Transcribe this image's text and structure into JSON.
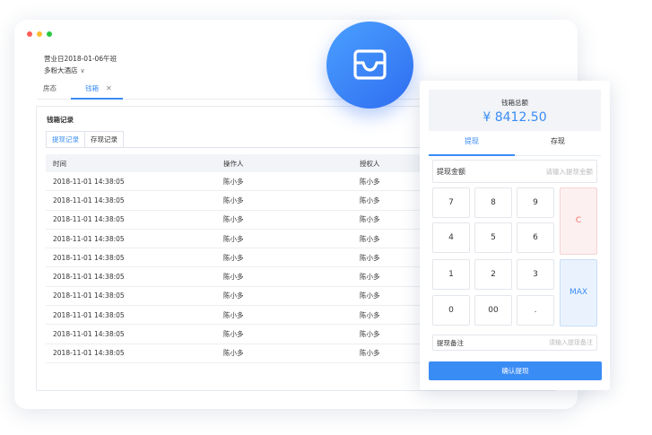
{
  "window_controls": {
    "colors": [
      "#ff5f57",
      "#ffbd2e",
      "#28c940"
    ]
  },
  "business_info": {
    "business_day": "营业日2018-01-06午班",
    "store": "多粉大酒店",
    "store_dropdown_icon": "chevron-down-icon"
  },
  "tabs": [
    {
      "label": "房态",
      "active": false
    },
    {
      "label": "钱箱",
      "active": true,
      "close_icon": "close-icon"
    }
  ],
  "panel": {
    "title": "钱箱记录",
    "subtabs": [
      {
        "label": "提现记录",
        "active": true
      },
      {
        "label": "存现记录",
        "active": false
      }
    ],
    "table": {
      "headers": [
        "时间",
        "操作人",
        "授权人"
      ],
      "rows": [
        [
          "2018-11-01 14:38:05",
          "陈小多",
          "陈小多"
        ],
        [
          "2018-11-01 14:38:05",
          "陈小多",
          "陈小多"
        ],
        [
          "2018-11-01 14:38:05",
          "陈小多",
          "陈小多"
        ],
        [
          "2018-11-01 14:38:05",
          "陈小多",
          "陈小多"
        ],
        [
          "2018-11-01 14:38:05",
          "陈小多",
          "陈小多"
        ],
        [
          "2018-11-01 14:38:05",
          "陈小多",
          "陈小多"
        ],
        [
          "2018-11-01 14:38:05",
          "陈小多",
          "陈小多"
        ],
        [
          "2018-11-01 14:38:05",
          "陈小多",
          "陈小多"
        ],
        [
          "2018-11-01 14:38:05",
          "陈小多",
          "陈小多"
        ],
        [
          "2018-11-01 14:38:05",
          "陈小多",
          "陈小多"
        ]
      ]
    }
  },
  "logo": {
    "icon": "cash-drawer-icon"
  },
  "cashier": {
    "label": "钱箱总额",
    "amount": "¥ 8412.50",
    "tabs": [
      {
        "label": "提现",
        "active": true
      },
      {
        "label": "存现",
        "active": false
      }
    ],
    "amount_field": {
      "label": "提现金额",
      "placeholder": "请输入提现金额"
    },
    "keypad": {
      "digits": [
        "7",
        "8",
        "9",
        "4",
        "5",
        "6",
        "1",
        "2",
        "3",
        "0",
        "00",
        "."
      ],
      "clear": "C",
      "max": "MAX"
    },
    "note_field": {
      "label": "提现备注",
      "placeholder": "请输入提现备注"
    },
    "confirm": "确认提现"
  },
  "colors": {
    "accent": "#3a8cf5",
    "clear_key": "#f56c6c"
  }
}
